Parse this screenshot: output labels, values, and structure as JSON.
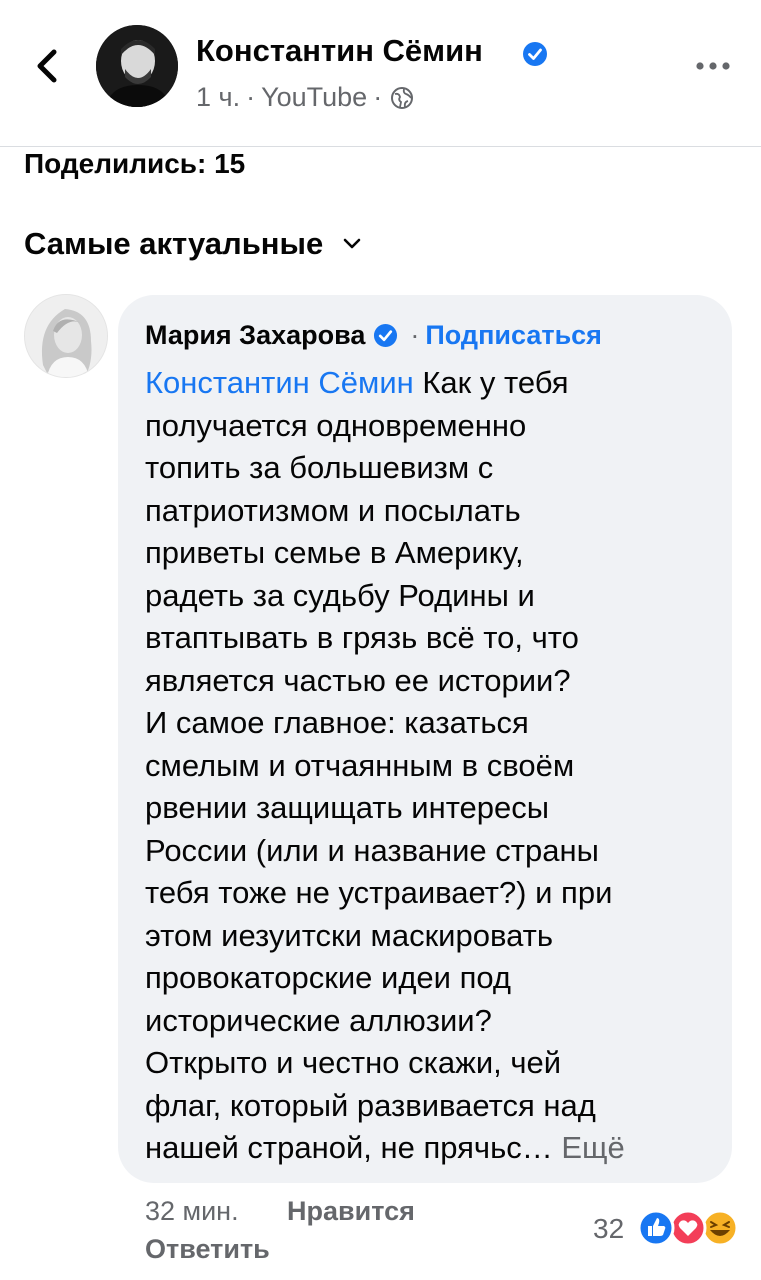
{
  "header": {
    "page_name": "Константин Сёмин",
    "time": "1 ч.",
    "separator": "·",
    "source": "YouTube",
    "verified_icon": "verified-badge-icon",
    "privacy_icon": "globe-icon"
  },
  "shares_label": "Поделились: 15",
  "sort_label": "Самые актуальные",
  "comment": {
    "author": "Мария Захарова",
    "separator": "·",
    "subscribe_label": "Подписаться",
    "mention": "Константин Сёмин",
    "first_line_rest": " Как у тебя",
    "lines": [
      "получается одновременно",
      "топить за большевизм с",
      "патриотизмом  и посылать",
      "приветы семье в Америку,",
      "радеть за судьбу Родины и",
      "втаптывать в грязь всё то, что",
      "является частью ее истории?",
      "И самое главное: казаться",
      "смелым и отчаянным в своём",
      "рвении защищать интересы",
      "России  (или и название страны",
      "тебя тоже не устраивает?) и при",
      "этом иезуитски маскировать",
      "провокаторские идеи под",
      "исторические аллюзии?",
      "Открыто и честно скажи, чей",
      "флаг, который развивается над"
    ],
    "last_line": "нашей страной, не прячьс…",
    "more_label": "Ещё",
    "time": "32 мин.",
    "like_label": "Нравится",
    "reply_label": "Ответить",
    "reaction_count": "32",
    "reaction_icons": [
      "like-reaction-icon",
      "love-reaction-icon",
      "haha-reaction-icon"
    ]
  },
  "colors": {
    "link_blue": "#1877f2",
    "secondary_text": "#65676b",
    "bubble_bg": "#f0f2f5",
    "like_blue": "#1877f2",
    "love_red": "#f33e58",
    "haha_yellow": "#f7b125"
  }
}
